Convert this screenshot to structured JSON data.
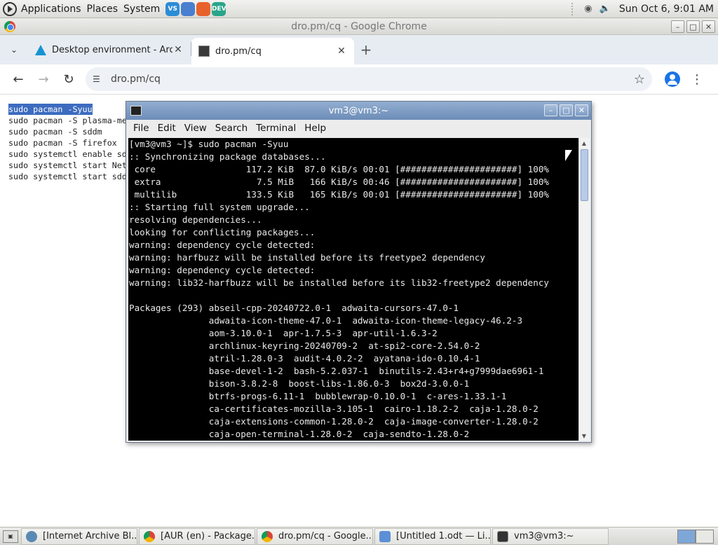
{
  "top_panel": {
    "menus": [
      "Applications",
      "Places",
      "System"
    ],
    "launchers": [
      {
        "name": "vscode",
        "color": "#2b8cd6",
        "label": "VS"
      },
      {
        "name": "chromium",
        "color": "#4a7fd0",
        "label": ""
      },
      {
        "name": "firefox",
        "color": "#e8632c",
        "label": ""
      },
      {
        "name": "edge-dev",
        "color": "#2aa58a",
        "label": "DEV"
      }
    ],
    "clock": "Sun Oct  6,  9:01 AM"
  },
  "chrome": {
    "window_title": "dro.pm/cq - Google Chrome",
    "tabs": [
      {
        "title": "Desktop environment - ArchWiki",
        "favicon": "arch-icon",
        "active": false
      },
      {
        "title": "dro.pm/cq",
        "favicon": "terminal-favicon",
        "active": true
      }
    ],
    "url": "dro.pm/cq"
  },
  "page": {
    "lines": [
      "sudo pacman -Syuu",
      "sudo pacman -S plasma-meta",
      "sudo pacman -S sddm",
      "sudo pacman -S firefox",
      "sudo systemctl enable sddm",
      "sudo systemctl start NetworkManager",
      "sudo systemctl start sddm"
    ],
    "selected_line": 0
  },
  "terminal": {
    "title": "vm3@vm3:~",
    "menus": [
      "File",
      "Edit",
      "View",
      "Search",
      "Terminal",
      "Help"
    ],
    "lines": [
      "[vm3@vm3 ~]$ sudo pacman -Syuu",
      ":: Synchronizing package databases...",
      " core                 117.2 KiB  87.0 KiB/s 00:01 [######################] 100%",
      " extra                  7.5 MiB   166 KiB/s 00:46 [######################] 100%",
      " multilib             133.5 KiB   165 KiB/s 00:01 [######################] 100%",
      ":: Starting full system upgrade...",
      "resolving dependencies...",
      "looking for conflicting packages...",
      "warning: dependency cycle detected:",
      "warning: harfbuzz will be installed before its freetype2 dependency",
      "warning: dependency cycle detected:",
      "warning: lib32-harfbuzz will be installed before its lib32-freetype2 dependency",
      "",
      "Packages (293) abseil-cpp-20240722.0-1  adwaita-cursors-47.0-1",
      "               adwaita-icon-theme-47.0-1  adwaita-icon-theme-legacy-46.2-3",
      "               aom-3.10.0-1  apr-1.7.5-3  apr-util-1.6.3-2",
      "               archlinux-keyring-20240709-2  at-spi2-core-2.54.0-2",
      "               atril-1.28.0-3  audit-4.0.2-2  ayatana-ido-0.10.4-1",
      "               base-devel-1-2  bash-5.2.037-1  binutils-2.43+r4+g7999dae6961-1",
      "               bison-3.8.2-8  boost-libs-1.86.0-3  box2d-3.0.0-1",
      "               btrfs-progs-6.11-1  bubblewrap-0.10.0-1  c-ares-1.33.1-1",
      "               ca-certificates-mozilla-3.105-1  cairo-1.18.2-2  caja-1.28.0-2",
      "               caja-extensions-common-1.28.0-2  caja-image-converter-1.28.0-2",
      "               caja-open-terminal-1.28.0-2  caja-sendto-1.28.0-2"
    ]
  },
  "taskbar": {
    "tasks": [
      {
        "title": "[Internet Archive Bl...",
        "icon": "ia",
        "active": false
      },
      {
        "title": "[AUR (en) - Package...",
        "icon": "chrome",
        "active": false
      },
      {
        "title": "dro.pm/cq - Google...",
        "icon": "chrome",
        "active": false
      },
      {
        "title": "[Untitled 1.odt — Li...",
        "icon": "doc",
        "active": false
      },
      {
        "title": "vm3@vm3:~",
        "icon": "term",
        "active": false
      }
    ]
  }
}
